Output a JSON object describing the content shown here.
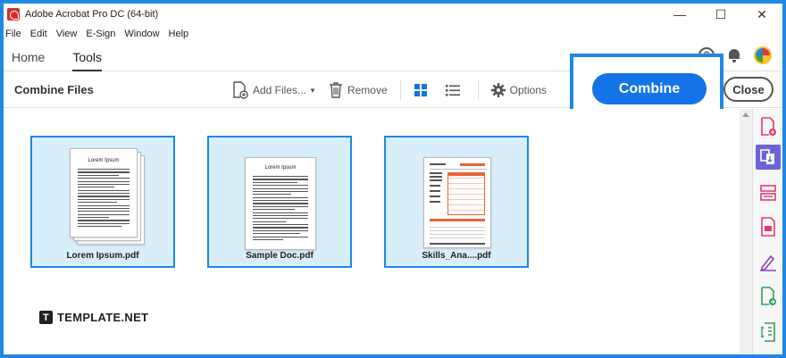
{
  "window": {
    "title": "Adobe Acrobat Pro DC (64-bit)",
    "minimize": "—",
    "maximize": "☐",
    "close": "✕"
  },
  "menu": [
    "File",
    "Edit",
    "View",
    "E-Sign",
    "Window",
    "Help"
  ],
  "nav": {
    "tabs": [
      {
        "label": "Home",
        "active": false
      },
      {
        "label": "Tools",
        "active": true
      }
    ],
    "help": "?"
  },
  "toolbar": {
    "title": "Combine Files",
    "add_files": "Add Files...",
    "remove": "Remove",
    "options": "Options",
    "combine": "Combine",
    "close": "Close"
  },
  "files": [
    {
      "name": "Lorem Ipsum.pdf",
      "doc_title": "Lorem Ipsum",
      "kind": "stack"
    },
    {
      "name": "Sample Doc.pdf",
      "doc_title": "Lorem Ipsum",
      "kind": "single"
    },
    {
      "name": "Skills_Ana....pdf",
      "doc_title": "",
      "kind": "form"
    }
  ],
  "branding": {
    "logo_mark": "T",
    "logo_text": "TEMPLATE.NET"
  },
  "rail_icons": [
    "create-pdf-icon",
    "combine-files-icon",
    "organize-pages-icon",
    "export-pdf-icon",
    "fill-sign-icon",
    "edit-pdf-icon",
    "compress-icon"
  ],
  "colors": {
    "accent": "#1473e6",
    "highlight_border": "#1e88e5",
    "selection_fill": "#d8eefa",
    "rail_active": "#6c63d8",
    "rail_icon": "#e53970"
  }
}
